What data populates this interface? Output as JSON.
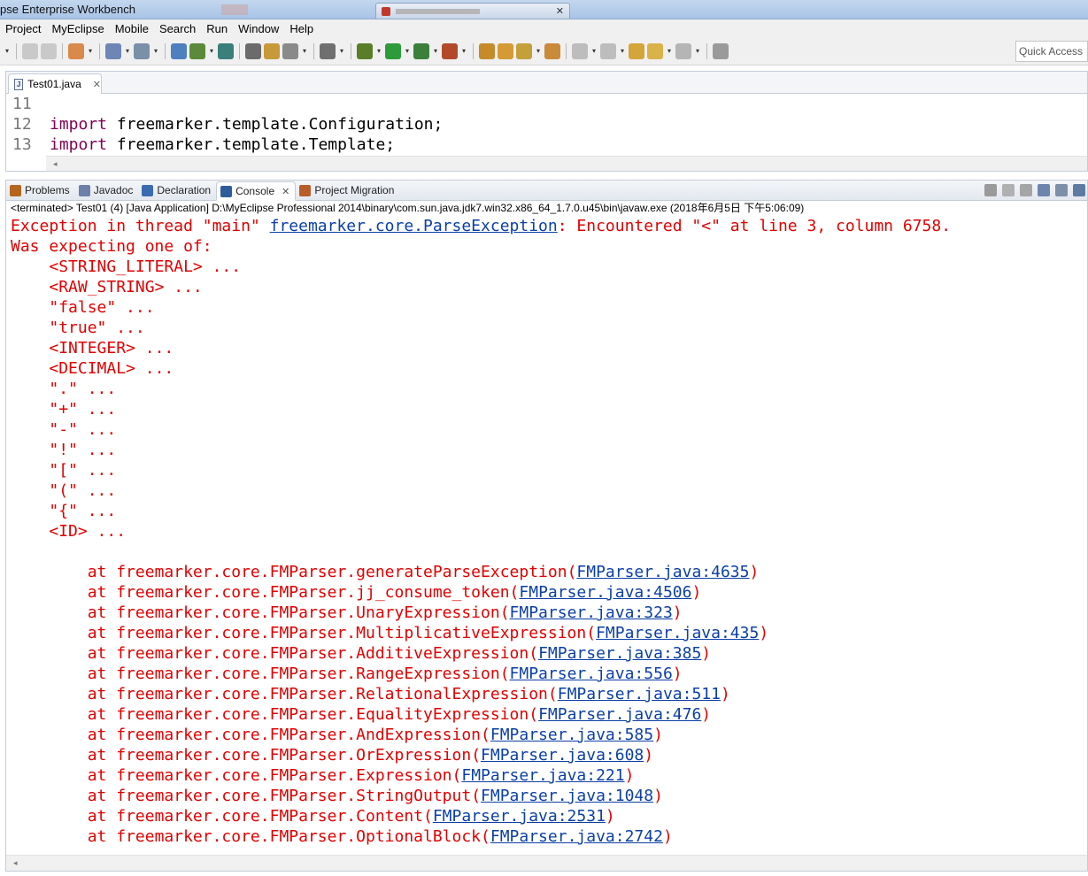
{
  "window": {
    "title": "pse Enterprise Workbench"
  },
  "menu": [
    "Project",
    "MyEclipse",
    "Mobile",
    "Search",
    "Run",
    "Window",
    "Help"
  ],
  "toolbar": {
    "quick_access_label": "Quick Access"
  },
  "editor": {
    "tab_label": "Test01.java",
    "lines": [
      {
        "num": "11",
        "keyword": "",
        "text": ""
      },
      {
        "num": "12",
        "keyword": "import",
        "text": " freemarker.template.Configuration;"
      },
      {
        "num": "13",
        "keyword": "import",
        "text": " freemarker.template.Template;"
      }
    ]
  },
  "views": {
    "tabs": [
      {
        "label": "Problems",
        "icon": "problems-icon",
        "color": "#b5651d"
      },
      {
        "label": "Javadoc",
        "icon": "javadoc-icon",
        "color": "#6b7fa8"
      },
      {
        "label": "Declaration",
        "icon": "declaration-icon",
        "color": "#3a6bb0"
      },
      {
        "label": "Console",
        "icon": "console-icon",
        "color": "#2e5c9a"
      },
      {
        "label": "Project Migration",
        "icon": "migration-icon",
        "color": "#b85c2a"
      }
    ],
    "active": "Console"
  },
  "console": {
    "status": "<terminated> Test01 (4) [Java Application] D:\\MyEclipse Professional 2014\\binary\\com.sun.java.jdk7.win32.x86_64_1.7.0.u45\\bin\\javaw.exe (2018年6月5日 下午5:06:09)",
    "exception_prefix": "Exception in thread \"main\" ",
    "exception_class": "freemarker.core.ParseException",
    "exception_message": ": Encountered \"<\" at line 3, column 6758.",
    "expecting_header": "Was expecting one of:",
    "expected_tokens": [
      "<STRING_LITERAL> ...",
      "<RAW_STRING> ...",
      "\"false\" ...",
      "\"true\" ...",
      "<INTEGER> ...",
      "<DECIMAL> ...",
      "\".\" ...",
      "\"+\" ...",
      "\"-\" ...",
      "\"!\" ...",
      "\"[\" ...",
      "\"(\" ...",
      "\"{\" ...",
      "<ID> ..."
    ],
    "stack": [
      {
        "method": "freemarker.core.FMParser.generateParseException",
        "link": "FMParser.java:4635"
      },
      {
        "method": "freemarker.core.FMParser.jj_consume_token",
        "link": "FMParser.java:4506"
      },
      {
        "method": "freemarker.core.FMParser.UnaryExpression",
        "link": "FMParser.java:323"
      },
      {
        "method": "freemarker.core.FMParser.MultiplicativeExpression",
        "link": "FMParser.java:435"
      },
      {
        "method": "freemarker.core.FMParser.AdditiveExpression",
        "link": "FMParser.java:385"
      },
      {
        "method": "freemarker.core.FMParser.RangeExpression",
        "link": "FMParser.java:556"
      },
      {
        "method": "freemarker.core.FMParser.RelationalExpression",
        "link": "FMParser.java:511"
      },
      {
        "method": "freemarker.core.FMParser.EqualityExpression",
        "link": "FMParser.java:476"
      },
      {
        "method": "freemarker.core.FMParser.AndExpression",
        "link": "FMParser.java:585"
      },
      {
        "method": "freemarker.core.FMParser.OrExpression",
        "link": "FMParser.java:608"
      },
      {
        "method": "freemarker.core.FMParser.Expression",
        "link": "FMParser.java:221"
      },
      {
        "method": "freemarker.core.FMParser.StringOutput",
        "link": "FMParser.java:1048"
      },
      {
        "method": "freemarker.core.FMParser.Content",
        "link": "FMParser.java:2531"
      },
      {
        "method": "freemarker.core.FMParser.OptionalBlock",
        "link": "FMParser.java:2742"
      }
    ]
  },
  "colors": {
    "error_text": "#e00000",
    "link": "#0b3fa6",
    "keyword": "#7f0055"
  }
}
